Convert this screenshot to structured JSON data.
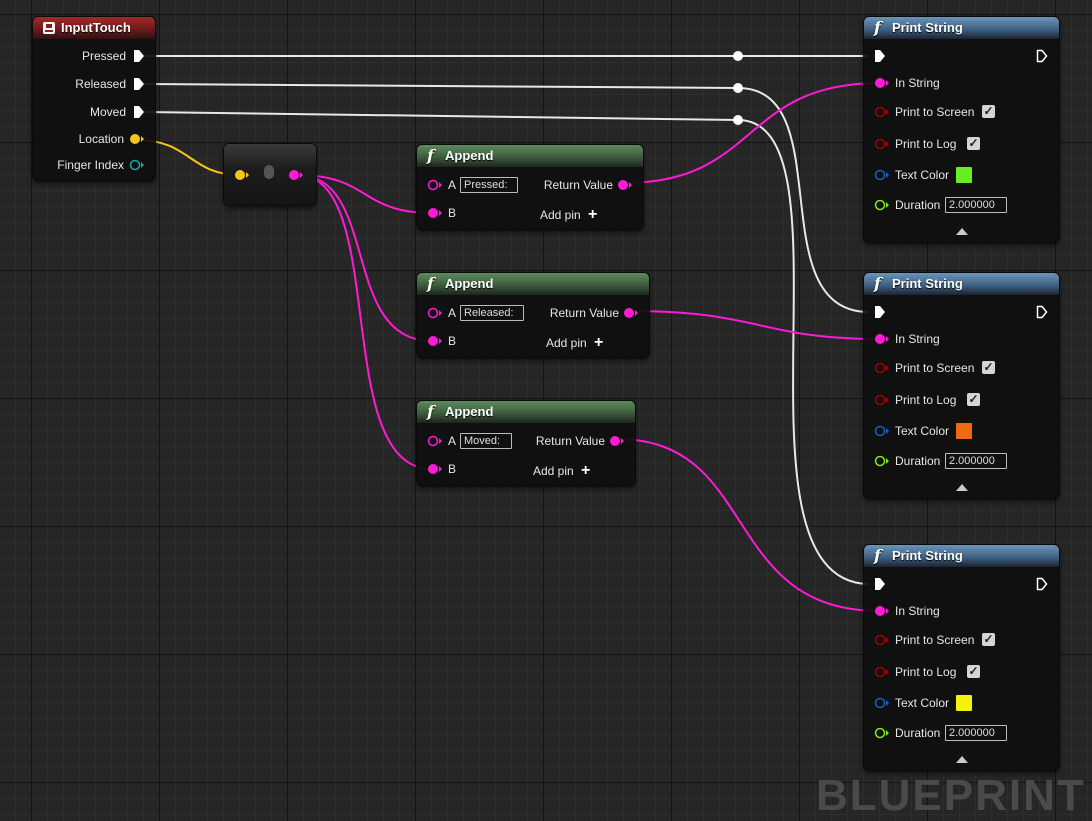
{
  "input_touch": {
    "title": "InputTouch",
    "pins": [
      "Pressed",
      "Released",
      "Moved",
      "Location",
      "Finger Index"
    ]
  },
  "appends": [
    {
      "title": "Append",
      "a_label": "A",
      "a_value": "Pressed:",
      "b_label": "B",
      "return_label": "Return Value",
      "add_pin": "Add pin"
    },
    {
      "title": "Append",
      "a_label": "A",
      "a_value": "Released:",
      "b_label": "B",
      "return_label": "Return Value",
      "add_pin": "Add pin"
    },
    {
      "title": "Append",
      "a_label": "A",
      "a_value": "Moved:",
      "b_label": "B",
      "return_label": "Return Value",
      "add_pin": "Add pin"
    }
  ],
  "print_strings": [
    {
      "title": "Print String",
      "in_string": "In String",
      "print_to_screen": "Print to Screen",
      "print_to_log": "Print to Log",
      "text_color_label": "Text Color",
      "text_color": "#66ee22",
      "duration_label": "Duration",
      "duration": "2.000000"
    },
    {
      "title": "Print String",
      "in_string": "In String",
      "print_to_screen": "Print to Screen",
      "print_to_log": "Print to Log",
      "text_color_label": "Text Color",
      "text_color": "#f26a10",
      "duration_label": "Duration",
      "duration": "2.000000"
    },
    {
      "title": "Print String",
      "in_string": "In String",
      "print_to_screen": "Print to Screen",
      "print_to_log": "Print to Log",
      "text_color_label": "Text Color",
      "text_color": "#f2f20e",
      "duration_label": "Duration",
      "duration": "2.000000"
    }
  ],
  "colors": {
    "exec": "#ffffff",
    "string": "#ff1ad6",
    "vector": "#f5c518",
    "int": "#1aa9a0",
    "bool": "#a00000",
    "linear_color": "#1160c9",
    "float": "#7fe81a"
  },
  "icons": {
    "input_touch": "event-icon",
    "function": "f-icon",
    "conversion": "vector-to-string-icon"
  },
  "watermark": "BLUEPRINT"
}
